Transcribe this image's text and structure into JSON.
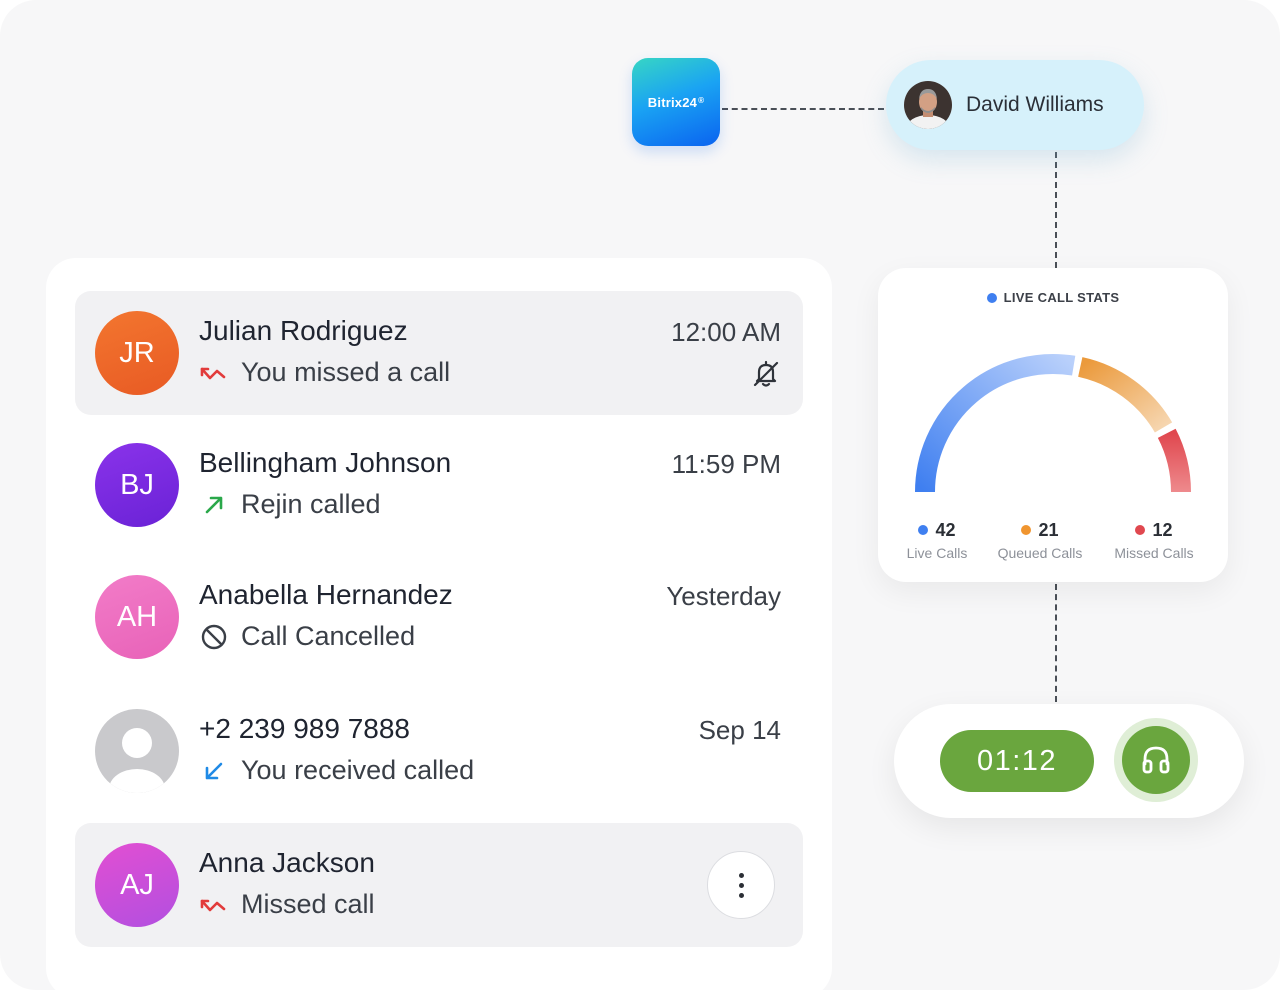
{
  "integration": {
    "logo_text": "Bitrix24",
    "logo_mark": "®"
  },
  "agent": {
    "name": "David Williams"
  },
  "calls": [
    {
      "initials": "JR",
      "name": "Julian Rodriguez",
      "status": "You missed a call",
      "status_icon": "missed-call-icon",
      "time": "12:00 AM",
      "avatar_color": "#ee6a2c",
      "highlighted": true
    },
    {
      "initials": "BJ",
      "name": "Bellingham Johnson",
      "status": "Rejin called",
      "status_icon": "outgoing-call-icon",
      "time": "11:59 PM",
      "avatar_color": "#7b2ce0"
    },
    {
      "initials": "AH",
      "name": "Anabella Hernandez",
      "status": "Call Cancelled",
      "status_icon": "cancelled-icon",
      "time": "Yesterday",
      "avatar_color": "#ee6fc1"
    },
    {
      "initials": "",
      "name": "+2 239 989 7888",
      "status": "You received called",
      "status_icon": "incoming-call-icon",
      "time": "Sep 14",
      "avatar_color": "#c9c9cc"
    },
    {
      "initials": "AJ",
      "name": "Anna Jackson",
      "status": "Missed call",
      "status_icon": "missed-call-icon",
      "time": "",
      "avatar_color": "#d04fd6",
      "highlighted": true
    }
  ],
  "stats": {
    "title": "LIVE CALL STATS",
    "colors": {
      "live": "#3f7ff0",
      "queued": "#f0952f",
      "missed": "#e0484f"
    },
    "live": {
      "value": "42",
      "label": "Live Calls"
    },
    "queued": {
      "value": "21",
      "label": "Queued Calls"
    },
    "missed": {
      "value": "12",
      "label": "Missed Calls"
    }
  },
  "call_control": {
    "timer": "01:12",
    "headset_icon": "headset-icon"
  }
}
